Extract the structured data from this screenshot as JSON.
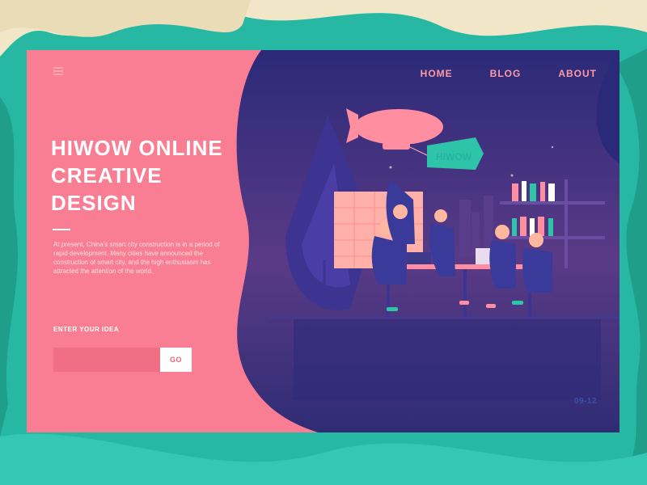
{
  "nav": {
    "menu_icon": "hamburger-icon",
    "items": [
      {
        "label": "HOME"
      },
      {
        "label": "BLOG"
      },
      {
        "label": "ABOUT"
      }
    ]
  },
  "hero": {
    "title": "HIWOW ONLINE\nCREATIVE\nDESIGN",
    "description": "At present, China's smart city construction is in a period of rapid development. Many cities have announced the construction of smart city, and the high enthusiasm has attracted the attention of the world."
  },
  "form": {
    "label": "ENTER YOUR IDEA",
    "input_value": "",
    "input_placeholder": "",
    "button_label": "GO"
  },
  "illustration": {
    "banner_text": "HIWOW"
  },
  "footer": {
    "date": "09-12"
  },
  "colors": {
    "background": "#26b8a3",
    "panel_pink": "#fa7e93",
    "scene_navy": "#2c2a72",
    "accent_pink": "#ff9aa6",
    "accent_teal": "#27b3a1"
  }
}
